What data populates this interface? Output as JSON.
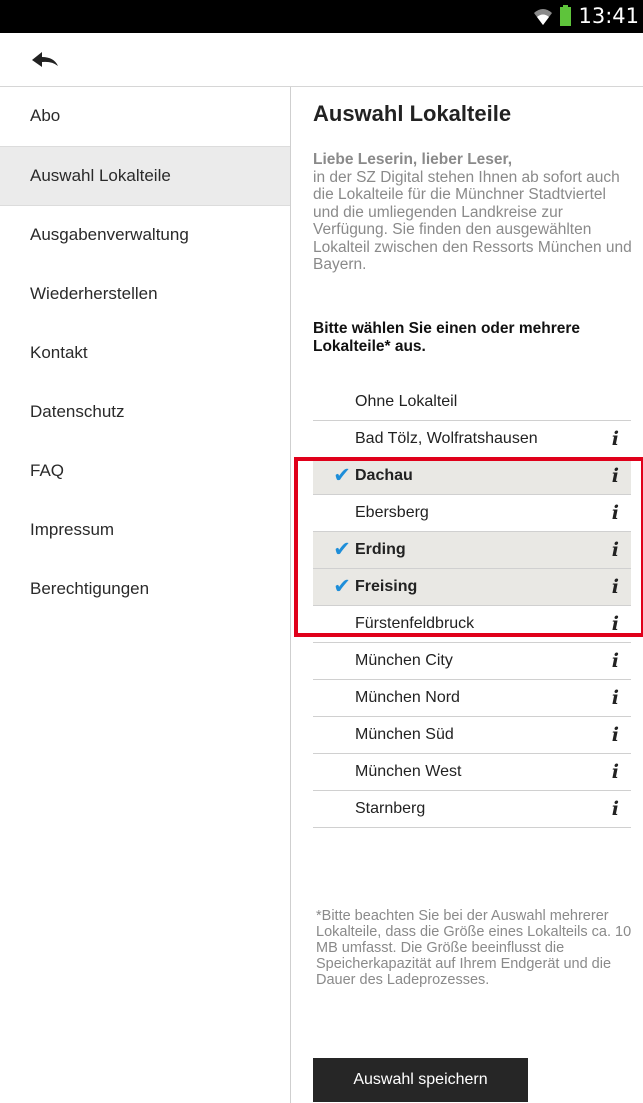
{
  "status_bar": {
    "time": "13:41",
    "icons": [
      "wifi-icon",
      "battery-icon"
    ]
  },
  "action_bar": {
    "back_icon": "back-arrow-icon"
  },
  "sidebar": {
    "items": [
      {
        "label": "Abo",
        "active": false
      },
      {
        "label": "Auswahl Lokalteile",
        "active": true
      },
      {
        "label": "Ausgabenverwaltung",
        "active": false
      },
      {
        "label": "Wiederherstellen",
        "active": false
      },
      {
        "label": "Kontakt",
        "active": false
      },
      {
        "label": "Datenschutz",
        "active": false
      },
      {
        "label": "FAQ",
        "active": false
      },
      {
        "label": "Impressum",
        "active": false
      },
      {
        "label": "Berechtigungen",
        "active": false
      }
    ]
  },
  "main": {
    "title": "Auswahl Lokalteile",
    "intro_lead": "Liebe Leserin, lieber Leser,",
    "intro_text": "in der SZ Digital stehen Ihnen ab sofort auch die Lokalteile für die Münchner Stadtviertel und die umliegenden Landkreise zur Verfügung. Sie finden den ausgewählten Lokalteil zwischen den Ressorts München und Bayern.",
    "prompt": "Bitte wählen Sie einen oder mehrere Lokalteile* aus.",
    "info_glyph": "i",
    "check_glyph": "✔",
    "options": [
      {
        "label": "Ohne Lokalteil",
        "selected": false,
        "info": false
      },
      {
        "label": "Bad Tölz, Wolfratshausen",
        "selected": false,
        "info": true
      },
      {
        "label": "Dachau",
        "selected": true,
        "info": true
      },
      {
        "label": "Ebersberg",
        "selected": false,
        "info": true
      },
      {
        "label": "Erding",
        "selected": true,
        "info": true
      },
      {
        "label": "Freising",
        "selected": true,
        "info": true
      },
      {
        "label": "Fürstenfeldbruck",
        "selected": false,
        "info": true
      },
      {
        "label": "München City",
        "selected": false,
        "info": true
      },
      {
        "label": "München Nord",
        "selected": false,
        "info": true
      },
      {
        "label": "München Süd",
        "selected": false,
        "info": true
      },
      {
        "label": "München West",
        "selected": false,
        "info": true
      },
      {
        "label": "Starnberg",
        "selected": false,
        "info": true
      }
    ],
    "footnote": "*Bitte beachten Sie bei der Auswahl mehrerer Lokalteile, dass die Größe eines Lokalteils ca. 10 MB umfasst. Die Größe beeinflusst die Speicherkapazität auf Ihrem Endgerät und die Dauer des Ladeprozesses.",
    "save_label": "Auswahl speichern"
  },
  "colors": {
    "accent": "#1e8ed9",
    "highlight": "#e0001a",
    "selected_row": "#e9e8e4",
    "button": "#262626"
  }
}
